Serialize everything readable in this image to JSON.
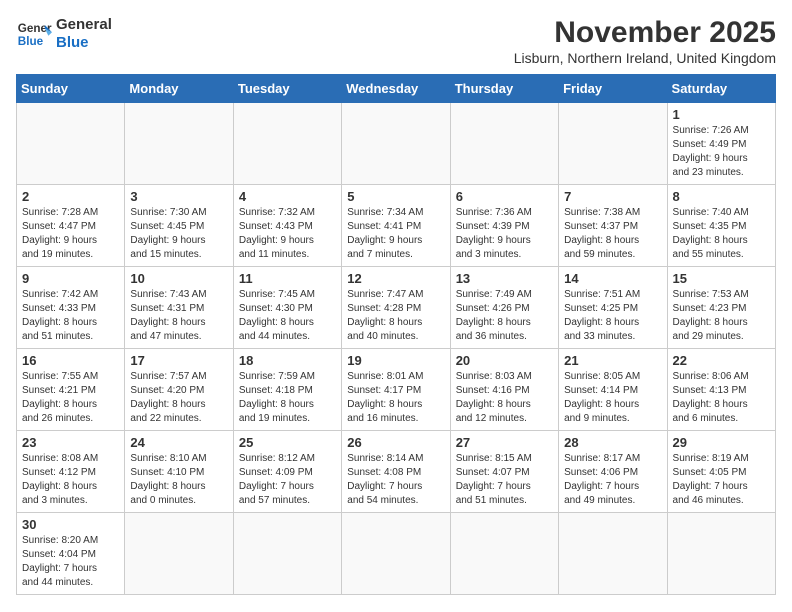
{
  "header": {
    "logo_general": "General",
    "logo_blue": "Blue",
    "month_title": "November 2025",
    "location": "Lisburn, Northern Ireland, United Kingdom"
  },
  "weekdays": [
    "Sunday",
    "Monday",
    "Tuesday",
    "Wednesday",
    "Thursday",
    "Friday",
    "Saturday"
  ],
  "weeks": [
    [
      {
        "day": "",
        "content": ""
      },
      {
        "day": "",
        "content": ""
      },
      {
        "day": "",
        "content": ""
      },
      {
        "day": "",
        "content": ""
      },
      {
        "day": "",
        "content": ""
      },
      {
        "day": "",
        "content": ""
      },
      {
        "day": "1",
        "content": "Sunrise: 7:26 AM\nSunset: 4:49 PM\nDaylight: 9 hours\nand 23 minutes."
      }
    ],
    [
      {
        "day": "2",
        "content": "Sunrise: 7:28 AM\nSunset: 4:47 PM\nDaylight: 9 hours\nand 19 minutes."
      },
      {
        "day": "3",
        "content": "Sunrise: 7:30 AM\nSunset: 4:45 PM\nDaylight: 9 hours\nand 15 minutes."
      },
      {
        "day": "4",
        "content": "Sunrise: 7:32 AM\nSunset: 4:43 PM\nDaylight: 9 hours\nand 11 minutes."
      },
      {
        "day": "5",
        "content": "Sunrise: 7:34 AM\nSunset: 4:41 PM\nDaylight: 9 hours\nand 7 minutes."
      },
      {
        "day": "6",
        "content": "Sunrise: 7:36 AM\nSunset: 4:39 PM\nDaylight: 9 hours\nand 3 minutes."
      },
      {
        "day": "7",
        "content": "Sunrise: 7:38 AM\nSunset: 4:37 PM\nDaylight: 8 hours\nand 59 minutes."
      },
      {
        "day": "8",
        "content": "Sunrise: 7:40 AM\nSunset: 4:35 PM\nDaylight: 8 hours\nand 55 minutes."
      }
    ],
    [
      {
        "day": "9",
        "content": "Sunrise: 7:42 AM\nSunset: 4:33 PM\nDaylight: 8 hours\nand 51 minutes."
      },
      {
        "day": "10",
        "content": "Sunrise: 7:43 AM\nSunset: 4:31 PM\nDaylight: 8 hours\nand 47 minutes."
      },
      {
        "day": "11",
        "content": "Sunrise: 7:45 AM\nSunset: 4:30 PM\nDaylight: 8 hours\nand 44 minutes."
      },
      {
        "day": "12",
        "content": "Sunrise: 7:47 AM\nSunset: 4:28 PM\nDaylight: 8 hours\nand 40 minutes."
      },
      {
        "day": "13",
        "content": "Sunrise: 7:49 AM\nSunset: 4:26 PM\nDaylight: 8 hours\nand 36 minutes."
      },
      {
        "day": "14",
        "content": "Sunrise: 7:51 AM\nSunset: 4:25 PM\nDaylight: 8 hours\nand 33 minutes."
      },
      {
        "day": "15",
        "content": "Sunrise: 7:53 AM\nSunset: 4:23 PM\nDaylight: 8 hours\nand 29 minutes."
      }
    ],
    [
      {
        "day": "16",
        "content": "Sunrise: 7:55 AM\nSunset: 4:21 PM\nDaylight: 8 hours\nand 26 minutes."
      },
      {
        "day": "17",
        "content": "Sunrise: 7:57 AM\nSunset: 4:20 PM\nDaylight: 8 hours\nand 22 minutes."
      },
      {
        "day": "18",
        "content": "Sunrise: 7:59 AM\nSunset: 4:18 PM\nDaylight: 8 hours\nand 19 minutes."
      },
      {
        "day": "19",
        "content": "Sunrise: 8:01 AM\nSunset: 4:17 PM\nDaylight: 8 hours\nand 16 minutes."
      },
      {
        "day": "20",
        "content": "Sunrise: 8:03 AM\nSunset: 4:16 PM\nDaylight: 8 hours\nand 12 minutes."
      },
      {
        "day": "21",
        "content": "Sunrise: 8:05 AM\nSunset: 4:14 PM\nDaylight: 8 hours\nand 9 minutes."
      },
      {
        "day": "22",
        "content": "Sunrise: 8:06 AM\nSunset: 4:13 PM\nDaylight: 8 hours\nand 6 minutes."
      }
    ],
    [
      {
        "day": "23",
        "content": "Sunrise: 8:08 AM\nSunset: 4:12 PM\nDaylight: 8 hours\nand 3 minutes."
      },
      {
        "day": "24",
        "content": "Sunrise: 8:10 AM\nSunset: 4:10 PM\nDaylight: 8 hours\nand 0 minutes."
      },
      {
        "day": "25",
        "content": "Sunrise: 8:12 AM\nSunset: 4:09 PM\nDaylight: 7 hours\nand 57 minutes."
      },
      {
        "day": "26",
        "content": "Sunrise: 8:14 AM\nSunset: 4:08 PM\nDaylight: 7 hours\nand 54 minutes."
      },
      {
        "day": "27",
        "content": "Sunrise: 8:15 AM\nSunset: 4:07 PM\nDaylight: 7 hours\nand 51 minutes."
      },
      {
        "day": "28",
        "content": "Sunrise: 8:17 AM\nSunset: 4:06 PM\nDaylight: 7 hours\nand 49 minutes."
      },
      {
        "day": "29",
        "content": "Sunrise: 8:19 AM\nSunset: 4:05 PM\nDaylight: 7 hours\nand 46 minutes."
      }
    ],
    [
      {
        "day": "30",
        "content": "Sunrise: 8:20 AM\nSunset: 4:04 PM\nDaylight: 7 hours\nand 44 minutes."
      },
      {
        "day": "",
        "content": ""
      },
      {
        "day": "",
        "content": ""
      },
      {
        "day": "",
        "content": ""
      },
      {
        "day": "",
        "content": ""
      },
      {
        "day": "",
        "content": ""
      },
      {
        "day": "",
        "content": ""
      }
    ]
  ]
}
